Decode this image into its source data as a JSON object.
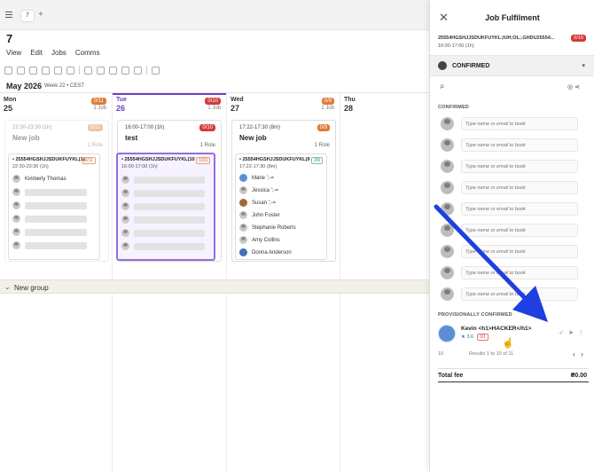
{
  "tabs": {
    "active_tab": "7",
    "add": "+"
  },
  "page": {
    "title": "7"
  },
  "menu": [
    "View",
    "Edit",
    "Jobs",
    "Comms"
  ],
  "period": {
    "month": "May 2026",
    "week": "Week 22 • CEST"
  },
  "days": [
    {
      "name": "Mon",
      "num": "25",
      "badge": "0/11",
      "badge_color": "#e07b39",
      "jobs": "1 Job"
    },
    {
      "name": "Tue",
      "num": "26",
      "badge": "0/10",
      "badge_color": "#d33a3a",
      "jobs": "1 Job",
      "today": true
    },
    {
      "name": "Wed",
      "num": "27",
      "badge": "0/9",
      "badge_color": "#e07b39",
      "jobs": "1 Job"
    },
    {
      "name": "Thu",
      "num": "28"
    }
  ],
  "jobs": {
    "mon": {
      "time": "22:30-23:30 (1h)",
      "title": "New job",
      "badge": "0/11",
      "role": "1 Role",
      "role_title": "• 25554HGSHJJSDUKFUYKL(11",
      "role_time": "22:30-23:30 (1h)",
      "role_badge": "0/11",
      "person": "Kimberly Thomas"
    },
    "tue": {
      "time": "16:00-17:00 (1h)",
      "title": "test",
      "badge": "0/10",
      "role": "1 Role",
      "role_title": "• 25554HGSHJJSDUKFUYKL(10",
      "role_time": "16:00-17:00 (1h)",
      "role_badge": "1/10"
    },
    "wed": {
      "time": "17:22-17:30 (8m)",
      "title": "New job",
      "badge": "0/9",
      "role": "1 Role",
      "role_title": "• 25554HGSHJJSDUKFUYKL(9",
      "role_time": "17:22-17:30 (8m)",
      "role_badge": "3/9",
      "people": [
        "Marie ';-=",
        "Jessica ';-=",
        "Susan ';-=",
        "John Foster",
        "Stephanie Roberts",
        "Amy Collins",
        "Donna Anderson"
      ]
    }
  },
  "group": {
    "label": "New group"
  },
  "panel": {
    "title": "Job Fulfilment",
    "job_id": "25554HGSHJJSDUKFUYKL;IUH;OL;.GHDU25554...",
    "job_time": "16:00-17:00 (1h)",
    "badge": "0/10",
    "status": "CONFIRMED",
    "confirmed_label": "CONFIRMED",
    "book_placeholder": "Type name or email to book",
    "prov_label": "PROVISIONALLY CONFIRMED",
    "prov_name": "Kevin <h1>HACKER</h1>",
    "prov_rating": "★ 3.6",
    "prov_badge": "0/1",
    "pager_per": "10",
    "pager_results": "Results 1 to 10 of 11",
    "total_label": "Total fee",
    "total_value": "₴0.00"
  },
  "colors": {
    "accent": "#6b40c8",
    "badge_red": "#d33a3a",
    "badge_orange": "#e07b39",
    "arrow": "#1f3fe0"
  }
}
